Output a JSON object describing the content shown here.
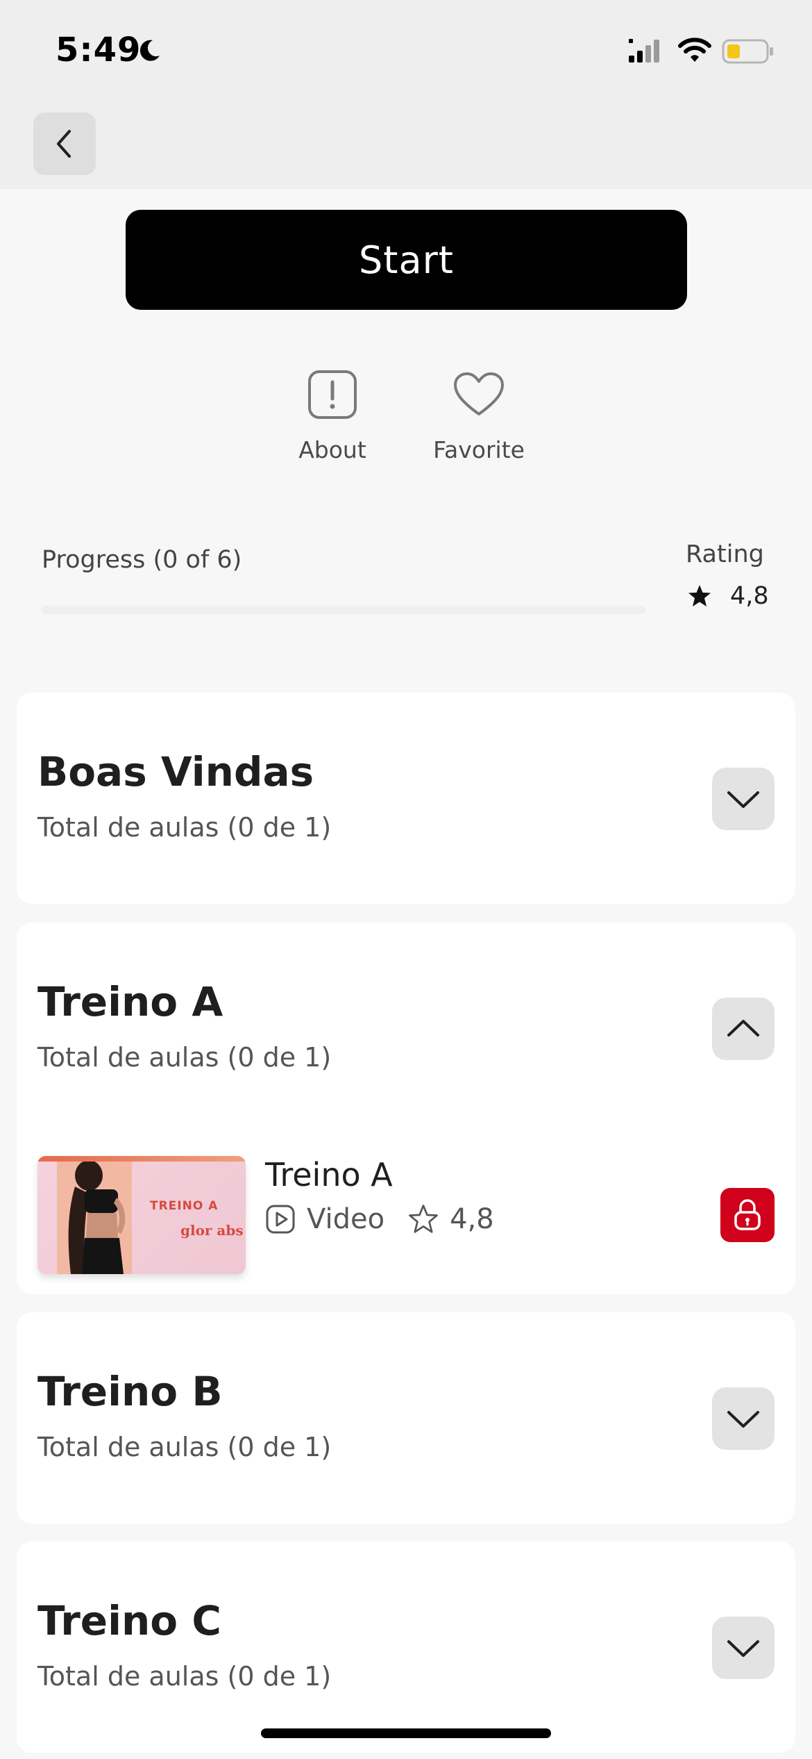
{
  "status_bar": {
    "time": "5:49"
  },
  "header": {
    "back_label": ""
  },
  "start_label": "Start",
  "actions": {
    "about_label": "About",
    "favorite_label": "Favorite"
  },
  "progress": {
    "label": "Progress (0 of 6)",
    "completed": 0,
    "total": 6,
    "fraction": 0
  },
  "rating": {
    "label": "Rating",
    "value": "4,8"
  },
  "modules": [
    {
      "title": "Boas Vindas",
      "subtitle": "Total de aulas (0 de 1)",
      "expanded": false
    },
    {
      "title": "Treino A",
      "subtitle": "Total de aulas (0 de 1)",
      "expanded": true,
      "lessons": [
        {
          "title": "Treino A",
          "type": "Video",
          "rating": "4,8",
          "thumbnail_text": "TREINO A",
          "thumbnail_logo": "glor abs",
          "locked": true
        }
      ]
    },
    {
      "title": "Treino B",
      "subtitle": "Total de aulas (0 de 1)",
      "expanded": false
    },
    {
      "title": "Treino C",
      "subtitle": "Total de aulas (0 de 1)",
      "expanded": false
    }
  ],
  "colors": {
    "accent": "#d0021b",
    "primary_button": "#000000",
    "background": "#f7f7f7",
    "card": "#ffffff",
    "battery_level": "#f5c518"
  },
  "icons": [
    "back-chevron-icon",
    "info-icon",
    "heart-icon",
    "star-icon",
    "chevron-down-icon",
    "chevron-up-icon",
    "play-icon",
    "lock-icon",
    "moon-icon",
    "signal-icon",
    "wifi-icon",
    "battery-icon"
  ]
}
